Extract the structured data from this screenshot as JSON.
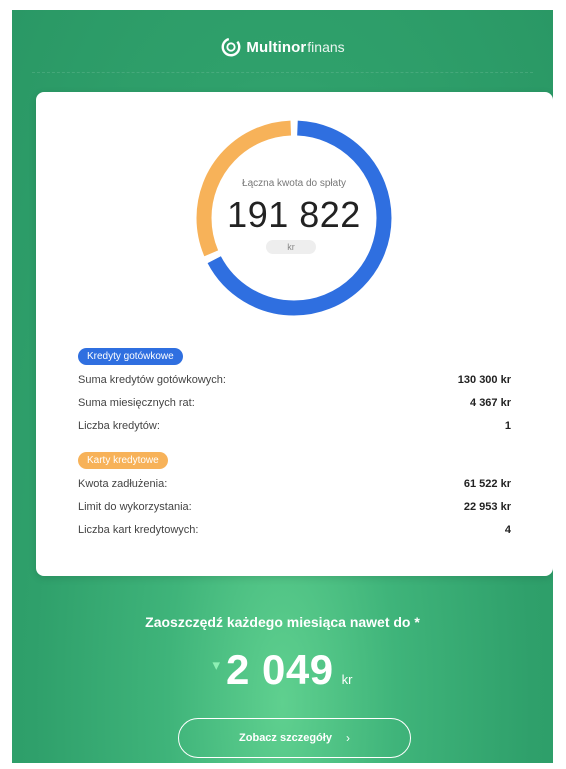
{
  "brand": {
    "name_strong": "Multinor",
    "name_light": "finans",
    "icon": "multinor-logo-icon"
  },
  "summary": {
    "label": "Łączna kwota do spłaty",
    "value": "191 822",
    "unit": "kr"
  },
  "donut": {
    "segments": [
      {
        "name": "Kredyty gotówkowe",
        "value": 130300,
        "color": "#2f6fe0"
      },
      {
        "name": "Karty kredytowe",
        "value": 61522,
        "color": "#f7b259"
      }
    ],
    "total": 191822
  },
  "cash_loans": {
    "badge": "Kredyty gotówkowe",
    "rows": [
      {
        "label": "Suma kredytów gotówkowych:",
        "value": "130 300 kr"
      },
      {
        "label": "Suma miesięcznych rat:",
        "value": "4 367 kr"
      },
      {
        "label": "Liczba kredytów:",
        "value": "1"
      }
    ]
  },
  "credit_cards": {
    "badge": "Karty kredytowe",
    "rows": [
      {
        "label": "Kwota zadłużenia:",
        "value": "61 522 kr"
      },
      {
        "label": "Limit do wykorzystania:",
        "value": "22 953 kr"
      },
      {
        "label": "Liczba kart kredytowych:",
        "value": "4"
      }
    ]
  },
  "savings": {
    "title": "Zaoszczędź każdego miesiąca nawet do *",
    "arrow": "▾",
    "amount": "2 049",
    "unit": "kr"
  },
  "details_button": {
    "label": "Zobacz szczegóły",
    "chevron": "›"
  },
  "colors": {
    "accent_blue": "#2f6fe0",
    "accent_orange": "#f7b259",
    "background_green": "#2fa06b"
  }
}
